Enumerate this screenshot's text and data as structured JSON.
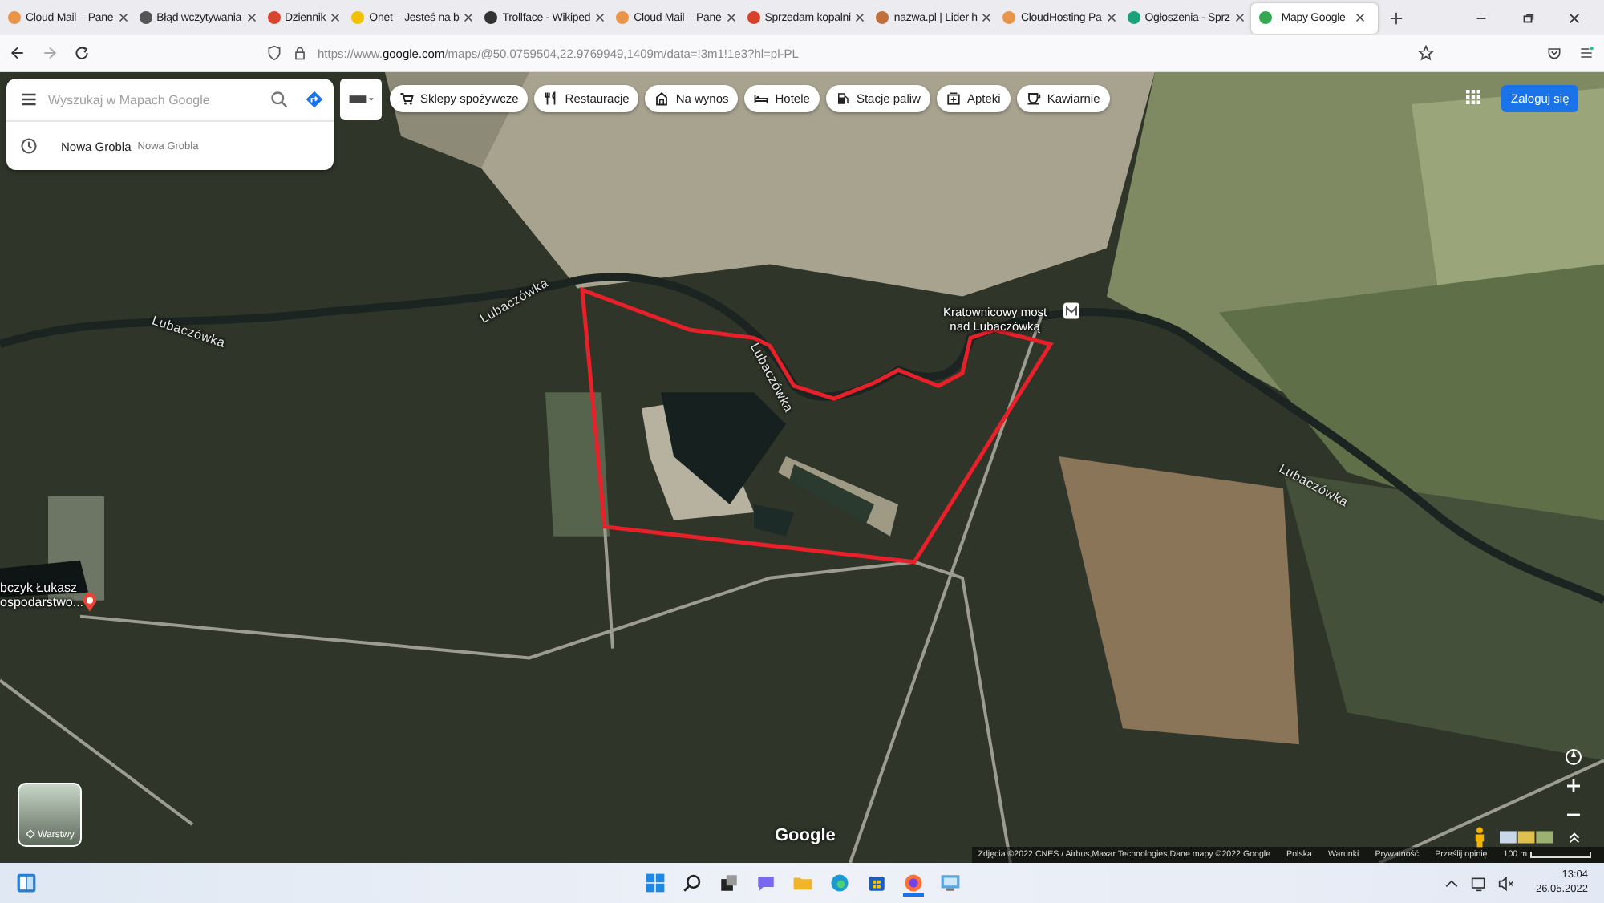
{
  "tabs": [
    {
      "title": "Cloud Mail – Pane",
      "selected": false,
      "color": "#e8954a"
    },
    {
      "title": "Błąd wczytywania",
      "selected": false,
      "color": "#555555"
    },
    {
      "title": "Dziennik",
      "selected": false,
      "color": "#d9442f"
    },
    {
      "title": "Onet – Jesteś na b",
      "selected": false,
      "color": "#f2c200"
    },
    {
      "title": "Trollface - Wikiped",
      "selected": false,
      "color": "#333333"
    },
    {
      "title": "Cloud Mail – Pane",
      "selected": false,
      "color": "#e8954a"
    },
    {
      "title": "Sprzedam kopalni",
      "selected": false,
      "color": "#d8402a"
    },
    {
      "title": "nazwa.pl | Lider h",
      "selected": false,
      "color": "#c0703a"
    },
    {
      "title": "CloudHosting Pa",
      "selected": false,
      "color": "#e8954a"
    },
    {
      "title": "Ogłoszenia - Sprz",
      "selected": false,
      "color": "#1aa37a"
    },
    {
      "title": "Mapy Google",
      "selected": true,
      "color": "#34a853"
    }
  ],
  "address_bar": {
    "url": "https://www.**google.com**/maps/@50.0759504,22.9769949,1409m/data=!3m1!1e3?hl=pl-PL"
  },
  "search": {
    "placeholder": "Wyszukaj w Mapach Google",
    "suggestion": {
      "name": "Nowa Grobla",
      "detail": "Nowa Grobla"
    }
  },
  "chips": [
    {
      "label": "Sklepy spożywcze",
      "kind": "cart"
    },
    {
      "label": "Restauracje",
      "kind": "cutlery"
    },
    {
      "label": "Na wynos",
      "kind": "takeout"
    },
    {
      "label": "Hotele",
      "kind": "bed"
    },
    {
      "label": "Stacje paliw",
      "kind": "fuel"
    },
    {
      "label": "Apteki",
      "kind": "pharmacy"
    },
    {
      "label": "Kawiarnie",
      "kind": "coffee"
    }
  ],
  "login_button": "Zaloguj się",
  "map_labels": [
    {
      "lines": [
        "Lubaczówka"
      ],
      "kind": "river"
    },
    {
      "lines": [
        "Lubaczówka"
      ],
      "kind": "river"
    },
    {
      "lines": [
        "Lubaczówka"
      ],
      "kind": "river"
    },
    {
      "lines": [
        "Lubaczówka"
      ],
      "kind": "river"
    },
    {
      "lines": [
        "Kratownicowy most",
        "nad Lubaczówką"
      ],
      "kind": "landmark"
    },
    {
      "lines": [
        "bczyk Łukasz",
        "ospodarstwo..."
      ],
      "kind": "place"
    }
  ],
  "layers_button": "Warstwy",
  "google_logo": "Google",
  "attribution": [
    "Zdjęcia ©2022 CNES / Airbus,Maxar Technologies,Dane mapy ©2022 Google",
    "Polska",
    "Warunki",
    "Prywatność",
    "Prześlij opinię"
  ],
  "scale": "100 m",
  "taskbar": {
    "time": "13:04",
    "date": "26.05.2022"
  }
}
